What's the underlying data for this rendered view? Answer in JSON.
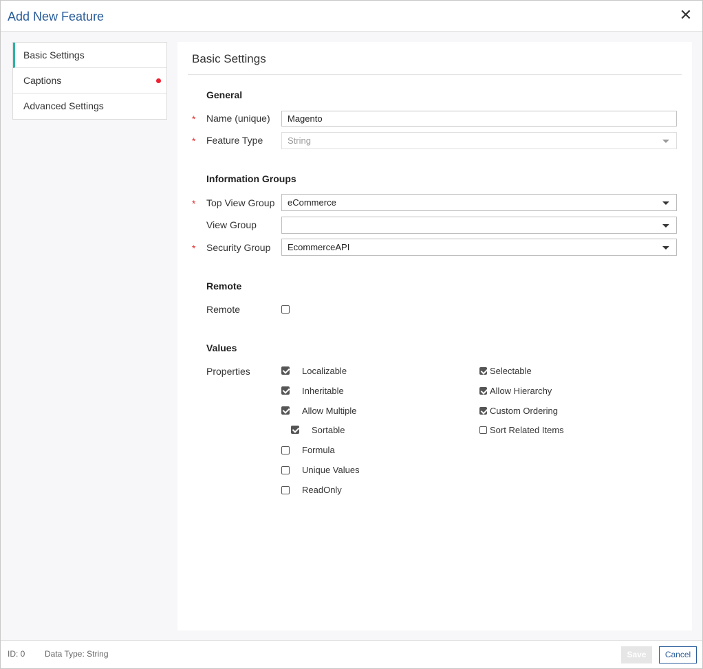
{
  "dialog": {
    "title": "Add New Feature",
    "close_glyph": "✕",
    "close_icon": "close-icon"
  },
  "nav": {
    "items": [
      {
        "label": "Basic Settings",
        "active": true
      },
      {
        "label": "Captions",
        "has_error": true
      },
      {
        "label": "Advanced Settings"
      }
    ]
  },
  "panel": {
    "title": "Basic Settings",
    "general": {
      "heading": "General",
      "name": {
        "label": "Name (unique)",
        "value": "Magento",
        "required": true
      },
      "feature_type": {
        "label": "Feature Type",
        "value": "String",
        "required": true,
        "disabled": true
      }
    },
    "groups": {
      "heading": "Information Groups",
      "top_view": {
        "label": "Top View Group",
        "value": "eCommerce",
        "required": true
      },
      "view": {
        "label": "View Group",
        "value": ""
      },
      "security": {
        "label": "Security Group",
        "value": "EcommerceAPI",
        "required": true
      }
    },
    "remote": {
      "heading": "Remote",
      "label": "Remote",
      "checked": false
    },
    "values": {
      "heading": "Values",
      "properties_label": "Properties",
      "left": [
        {
          "label": "Localizable",
          "checked": true
        },
        {
          "label": "Inheritable",
          "checked": true
        },
        {
          "label": "Allow Multiple",
          "checked": true
        },
        {
          "label": "Sortable",
          "checked": true
        },
        {
          "label": "Formula",
          "checked": false
        },
        {
          "label": "Unique Values",
          "checked": false
        },
        {
          "label": "ReadOnly",
          "checked": false
        }
      ],
      "right": [
        {
          "label": "Selectable",
          "checked": true
        },
        {
          "label": "Allow Hierarchy",
          "checked": true
        },
        {
          "label": "Custom Ordering",
          "checked": true
        },
        {
          "label": "Sort Related Items",
          "checked": false
        }
      ]
    },
    "required_marker": "*"
  },
  "footer": {
    "id_text": "ID: 0",
    "data_type_text": "Data Type: String",
    "save_label": "Save",
    "cancel_label": "Cancel"
  },
  "colors": {
    "title": "#2a5d9a",
    "active_tab_accent": "#2ab3a6",
    "required": "#e03030",
    "error_dot": "#ee2233"
  }
}
